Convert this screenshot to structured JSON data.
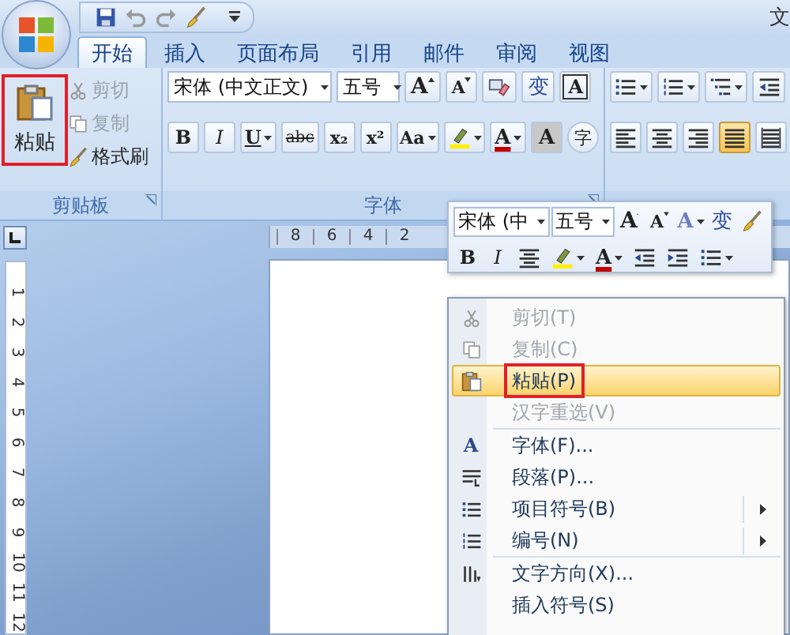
{
  "title_bar": {
    "title": "文",
    "quick_access": [
      {
        "kind": "save",
        "disabled": false
      },
      {
        "kind": "undo",
        "disabled": true
      },
      {
        "kind": "redo",
        "disabled": true
      },
      {
        "kind": "brush",
        "disabled": false
      }
    ]
  },
  "tabs": [
    {
      "label": "开始",
      "selected": true
    },
    {
      "label": "插入",
      "selected": false
    },
    {
      "label": "页面布局",
      "selected": false
    },
    {
      "label": "引用",
      "selected": false
    },
    {
      "label": "邮件",
      "selected": false
    },
    {
      "label": "审阅",
      "selected": false
    },
    {
      "label": "视图",
      "selected": false
    }
  ],
  "ribbon": {
    "clipboard": {
      "label": "剪贴板",
      "paste": {
        "label": "粘贴",
        "marked": true
      },
      "items": [
        {
          "label": "剪切",
          "kind": "scissors",
          "disabled": true
        },
        {
          "label": "复制",
          "kind": "copy",
          "disabled": true
        },
        {
          "label": "格式刷",
          "kind": "brush",
          "disabled": false
        }
      ]
    },
    "font": {
      "label": "字体",
      "font_name": "宋体 (中文正文)",
      "font_size": "五号",
      "row1": [
        {
          "kind": "grow",
          "label": "A",
          "dropdown": false
        },
        {
          "kind": "shrink",
          "label": "A",
          "dropdown": false
        },
        {
          "kind": "clear",
          "dropdown": false
        },
        {
          "kind": "phonetic",
          "label": "变",
          "dropdown": false
        },
        {
          "kind": "border",
          "label": "A",
          "dropdown": false
        }
      ],
      "row2": [
        {
          "kind": "bold",
          "label": "B",
          "dropdown": false
        },
        {
          "kind": "italic",
          "label": "I",
          "dropdown": false
        },
        {
          "kind": "underline",
          "label": "U",
          "dropdown": true
        },
        {
          "kind": "strike",
          "label": "abc",
          "dropdown": false
        },
        {
          "kind": "subscript",
          "label": "x₂",
          "dropdown": false
        },
        {
          "kind": "superscript",
          "label": "x²",
          "dropdown": false
        },
        {
          "kind": "case",
          "label": "Aa",
          "dropdown": true
        },
        {
          "kind": "highlight",
          "dropdown": true
        },
        {
          "kind": "color",
          "label": "A",
          "dropdown": true
        },
        {
          "kind": "shade",
          "label": "A",
          "dropdown": false
        },
        {
          "kind": "enclose",
          "label": "字",
          "dropdown": false
        }
      ]
    },
    "paragraph": {
      "row1": [
        {
          "kind": "bullets",
          "dropdown": true
        },
        {
          "kind": "numbering",
          "dropdown": true
        },
        {
          "kind": "multilevel",
          "dropdown": true
        },
        {
          "kind": "outdent",
          "dropdown": false
        }
      ],
      "row2": [
        {
          "kind": "align_left",
          "selected": false
        },
        {
          "kind": "center",
          "selected": false
        },
        {
          "kind": "align_right",
          "selected": false
        },
        {
          "kind": "justify",
          "selected": true
        },
        {
          "kind": "distribute",
          "selected": false
        }
      ]
    }
  },
  "ruler": {
    "horizontal": [
      "8",
      "6",
      "4",
      "2"
    ],
    "vertical": [
      "1",
      "2",
      "3",
      "4",
      "5",
      "6",
      "7",
      "8",
      "9",
      "10",
      "11",
      "12"
    ]
  },
  "mini_toolbar": {
    "font_name": "宋体 (中",
    "font_size": "五号",
    "row1": [
      {
        "kind": "grow",
        "label": "A",
        "dropdown": false
      },
      {
        "kind": "shrink",
        "label": "A",
        "dropdown": false
      },
      {
        "kind": "styles",
        "label": "A",
        "dropdown": true
      },
      {
        "kind": "phonetic",
        "label": "变",
        "dropdown": false
      },
      {
        "kind": "brush",
        "dropdown": false
      }
    ],
    "row2": [
      {
        "kind": "bold",
        "label": "B",
        "dropdown": false
      },
      {
        "kind": "italic",
        "label": "I",
        "dropdown": false
      },
      {
        "kind": "center",
        "dropdown": false
      },
      {
        "kind": "highlight",
        "dropdown": true
      },
      {
        "kind": "color",
        "label": "A",
        "dropdown": true
      },
      {
        "kind": "outdent",
        "dropdown": false
      },
      {
        "kind": "indent",
        "dropdown": false
      },
      {
        "kind": "bullets",
        "dropdown": true
      }
    ]
  },
  "context_menu": [
    {
      "kind": "scissors",
      "label": "剪切(T)",
      "disabled": true,
      "selected": false,
      "marked": false,
      "submenu": false
    },
    {
      "kind": "copy",
      "label": "复制(C)",
      "disabled": true,
      "selected": false,
      "marked": false,
      "submenu": false
    },
    {
      "kind": "paste",
      "label": "粘贴(P)",
      "disabled": false,
      "selected": true,
      "marked": true,
      "submenu": false
    },
    {
      "kind": "plain",
      "label": "汉字重选(V)",
      "disabled": true,
      "selected": false,
      "marked": false,
      "submenu": false
    },
    {
      "kind": "separator"
    },
    {
      "kind": "glyph",
      "glyph": "A",
      "label": "字体(F)...",
      "disabled": false,
      "selected": false,
      "marked": false,
      "submenu": false
    },
    {
      "kind": "paragraph",
      "label": "段落(P)...",
      "disabled": false,
      "selected": false,
      "marked": false,
      "submenu": false
    },
    {
      "kind": "bullets",
      "label": "项目符号(B)",
      "disabled": false,
      "selected": false,
      "marked": false,
      "submenu": true
    },
    {
      "kind": "numbering",
      "label": "编号(N)",
      "disabled": false,
      "selected": false,
      "marked": false,
      "submenu": true
    },
    {
      "kind": "separator"
    },
    {
      "kind": "direction",
      "label": "文字方向(X)...",
      "disabled": false,
      "selected": false,
      "marked": false,
      "submenu": false
    },
    {
      "kind": "plain",
      "label": "插入符号(S)",
      "disabled": false,
      "selected": false,
      "marked": false,
      "submenu": false
    }
  ]
}
